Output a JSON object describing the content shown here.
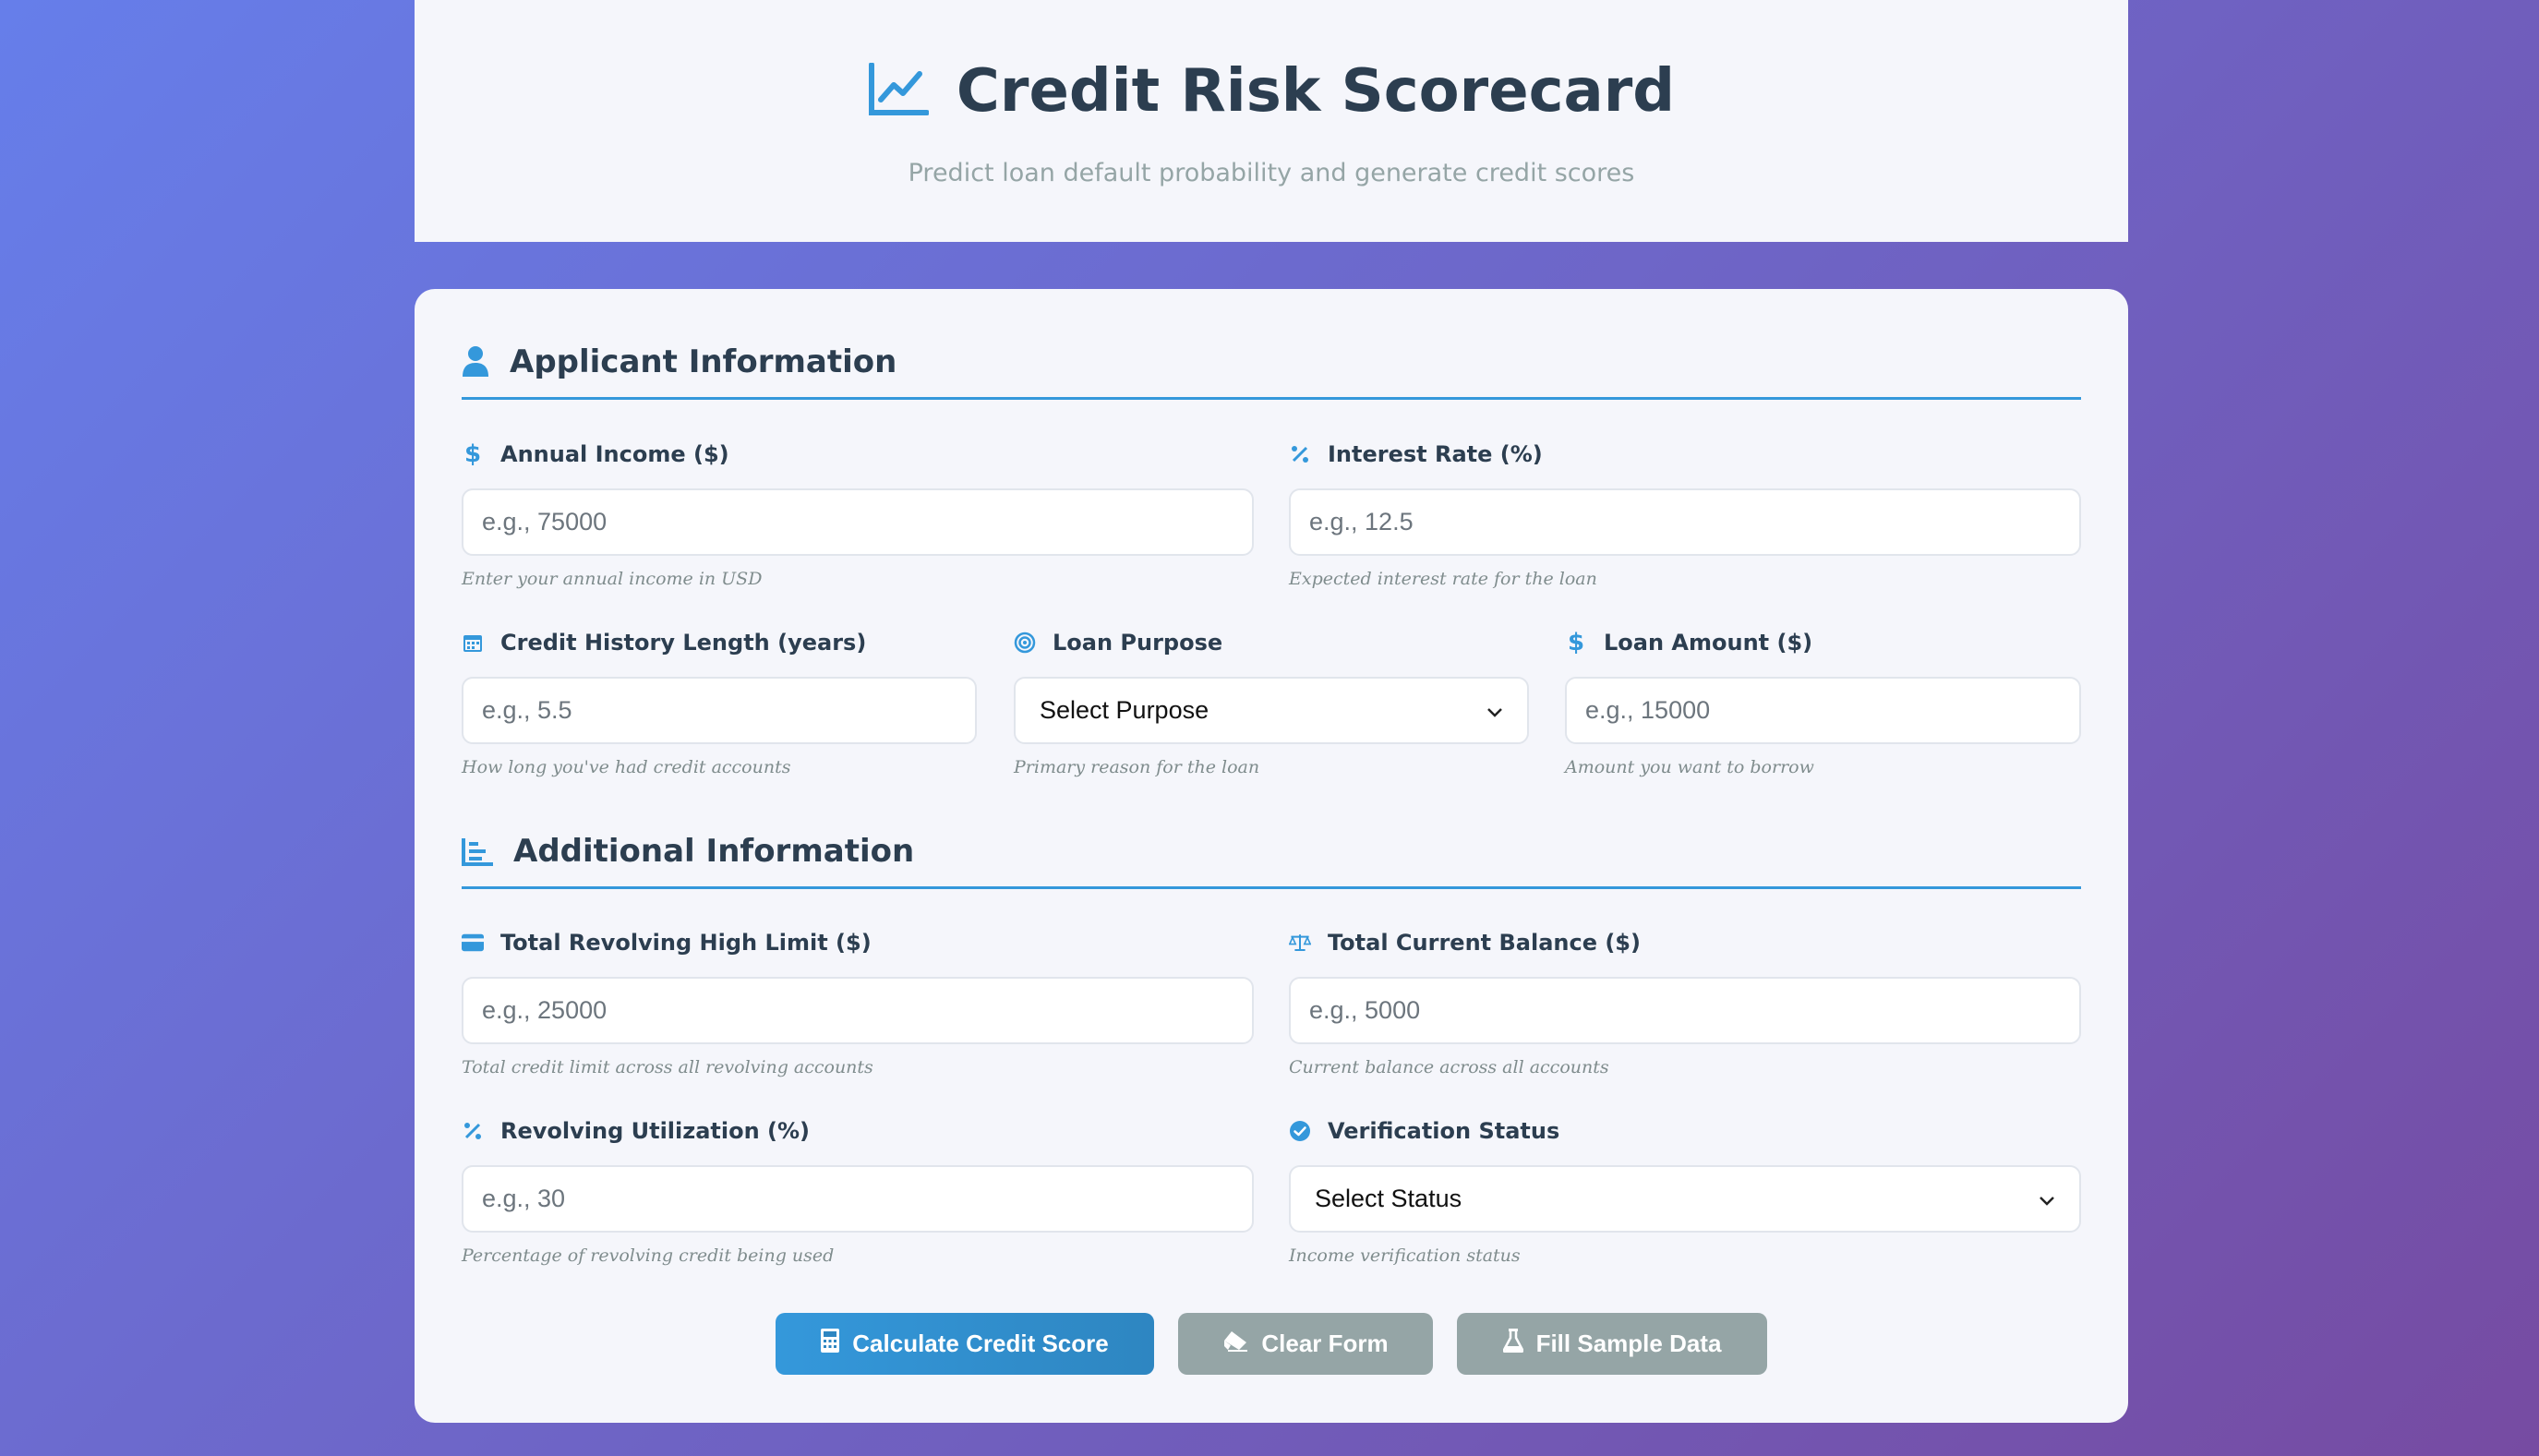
{
  "header": {
    "title": "Credit Risk Scorecard",
    "subtitle": "Predict loan default probability and generate credit scores",
    "icon": "chart-line-icon"
  },
  "sections": {
    "applicant": {
      "title": "Applicant Information",
      "icon": "user-icon"
    },
    "additional": {
      "title": "Additional Information",
      "icon": "bar-chart-icon"
    }
  },
  "fields": {
    "annual_income": {
      "label": "Annual Income ($)",
      "placeholder": "e.g., 75000",
      "hint": "Enter your annual income in USD",
      "icon": "dollar-icon"
    },
    "interest_rate": {
      "label": "Interest Rate (%)",
      "placeholder": "e.g., 12.5",
      "hint": "Expected interest rate for the loan",
      "icon": "percent-icon"
    },
    "credit_history": {
      "label": "Credit History Length (years)",
      "placeholder": "e.g., 5.5",
      "hint": "How long you've had credit accounts",
      "icon": "calendar-icon"
    },
    "loan_purpose": {
      "label": "Loan Purpose",
      "value": "Select Purpose",
      "hint": "Primary reason for the loan",
      "icon": "target-icon"
    },
    "loan_amount": {
      "label": "Loan Amount ($)",
      "placeholder": "e.g., 15000",
      "hint": "Amount you want to borrow",
      "icon": "dollar-icon"
    },
    "revolving_limit": {
      "label": "Total Revolving High Limit ($)",
      "placeholder": "e.g., 25000",
      "hint": "Total credit limit across all revolving accounts",
      "icon": "credit-card-icon"
    },
    "current_balance": {
      "label": "Total Current Balance ($)",
      "placeholder": "e.g., 5000",
      "hint": "Current balance across all accounts",
      "icon": "scale-icon"
    },
    "revolving_util": {
      "label": "Revolving Utilization (%)",
      "placeholder": "e.g., 30",
      "hint": "Percentage of revolving credit being used",
      "icon": "percent-icon"
    },
    "verification": {
      "label": "Verification Status",
      "value": "Select Status",
      "hint": "Income verification status",
      "icon": "check-circle-icon"
    }
  },
  "buttons": {
    "calculate": "Calculate Credit Score",
    "clear": "Clear Form",
    "sample": "Fill Sample Data"
  },
  "colors": {
    "accent": "#3498db",
    "heading": "#2c3e50",
    "secondary_button": "#95a5a6"
  }
}
